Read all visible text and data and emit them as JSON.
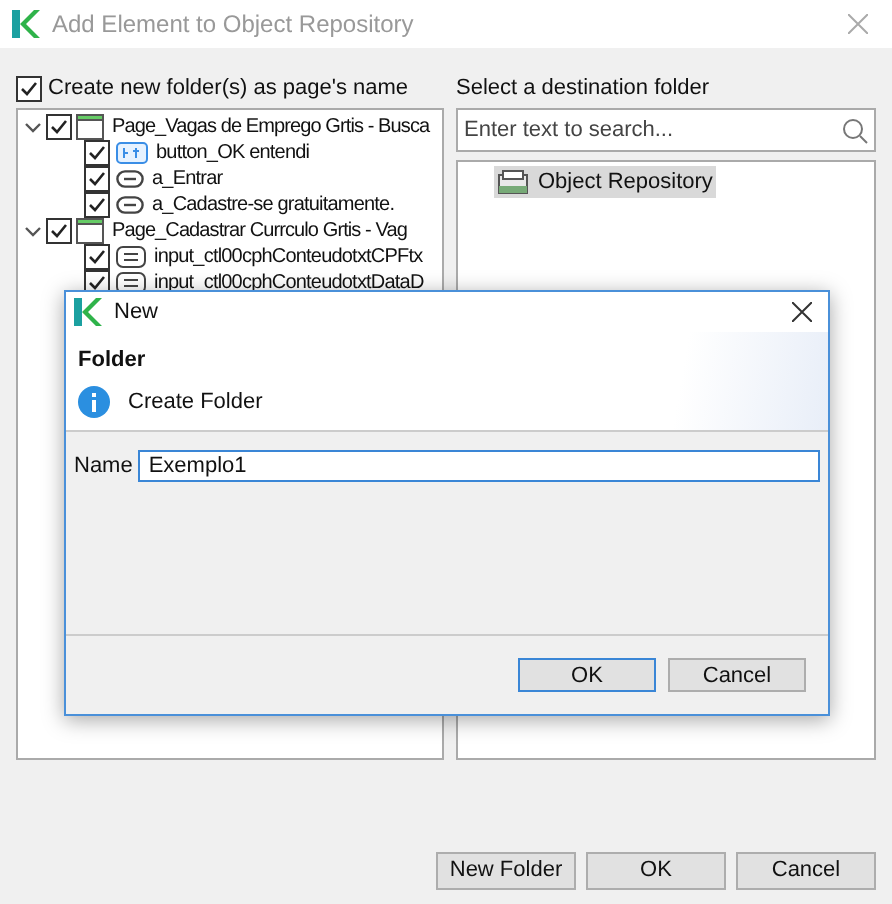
{
  "window": {
    "title": "Add Element to Object Repository"
  },
  "create_folder": {
    "label": "Create new folder(s) as page's name",
    "checked": true
  },
  "elements": [
    {
      "label": "Page_Vagas de Emprego Grtis - Busca",
      "kind": "page",
      "checked": true,
      "expanded": true,
      "children": [
        {
          "label": "button_OK entendi",
          "kind": "button",
          "checked": true
        },
        {
          "label": "a_Entrar",
          "kind": "link",
          "checked": true
        },
        {
          "label": "a_Cadastre-se gratuitamente.",
          "kind": "link",
          "checked": true
        }
      ]
    },
    {
      "label": "Page_Cadastrar Currculo Grtis - Vag",
      "kind": "page",
      "checked": true,
      "expanded": true,
      "children": [
        {
          "label": "input_ctl00cphConteudotxtCPFtx",
          "kind": "input",
          "checked": true
        },
        {
          "label": "input_ctl00cphConteudotxtDataD",
          "kind": "input",
          "checked": true
        }
      ]
    }
  ],
  "destination": {
    "label": "Select a destination folder",
    "search": {
      "placeholder": "Enter text to search..."
    },
    "folders": [
      {
        "label": "Object Repository",
        "selected": true
      }
    ]
  },
  "buttons": [
    "New Folder",
    "OK",
    "Cancel"
  ],
  "dialog": {
    "title": "New",
    "heading": "Folder",
    "message": "Create Folder",
    "name_label": "Name",
    "name_value": "Exemplo1",
    "buttons": [
      {
        "label": "OK",
        "default": true
      },
      {
        "label": "Cancel",
        "default": false
      }
    ]
  }
}
